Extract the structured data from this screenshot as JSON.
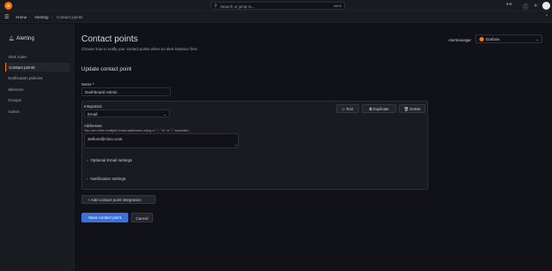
{
  "search": {
    "placeholder": "Search or jump to...",
    "shortcut": "ctrl+k"
  },
  "breadcrumb": [
    "Home",
    "Alerting",
    "Contact points"
  ],
  "sidebar": {
    "title": "Alerting",
    "items": [
      {
        "label": "Alert rules",
        "active": false
      },
      {
        "label": "Contact points",
        "active": true
      },
      {
        "label": "Notification policies",
        "active": false
      },
      {
        "label": "Silences",
        "active": false
      },
      {
        "label": "Groups",
        "active": false
      },
      {
        "label": "Admin",
        "active": false
      }
    ]
  },
  "page": {
    "title": "Contact points",
    "subtitle": "Choose how to notify your contact points when an alert instance fires",
    "alertmanager_label": "Alertmanager",
    "alertmanager_value": "Grafana"
  },
  "form": {
    "section_title": "Update contact point",
    "name_label": "Name *",
    "name_value": "Dashboard Admin",
    "integration_label": "Integration",
    "integration_value": "Email",
    "buttons": {
      "test": "Test",
      "duplicate": "Duplicate",
      "delete": "Delete"
    },
    "addresses_label": "Addresses",
    "addresses_hint": "You can enter multiple email addresses using a \";\", \"\\n\" or \",\" separator",
    "addresses_value": "stefiore@cisco.com",
    "optional_settings": "Optional Email settings",
    "notification_settings": "Notification settings",
    "add_integration": "Add contact point integration",
    "save": "Save contact point",
    "cancel": "Cancel"
  },
  "colors": {
    "accent": "#ff7a00",
    "primary": "#3d71d9",
    "background": "#111217",
    "panel": "#181b1f"
  },
  "icons": [
    "grafana-logo-icon",
    "search-icon",
    "plus-icon",
    "help-icon",
    "rss-icon",
    "avatar-icon",
    "menu-icon",
    "bell-icon",
    "chevron-down-icon",
    "chevron-right-icon",
    "play-icon",
    "copy-icon",
    "trash-icon",
    "plus-icon"
  ]
}
